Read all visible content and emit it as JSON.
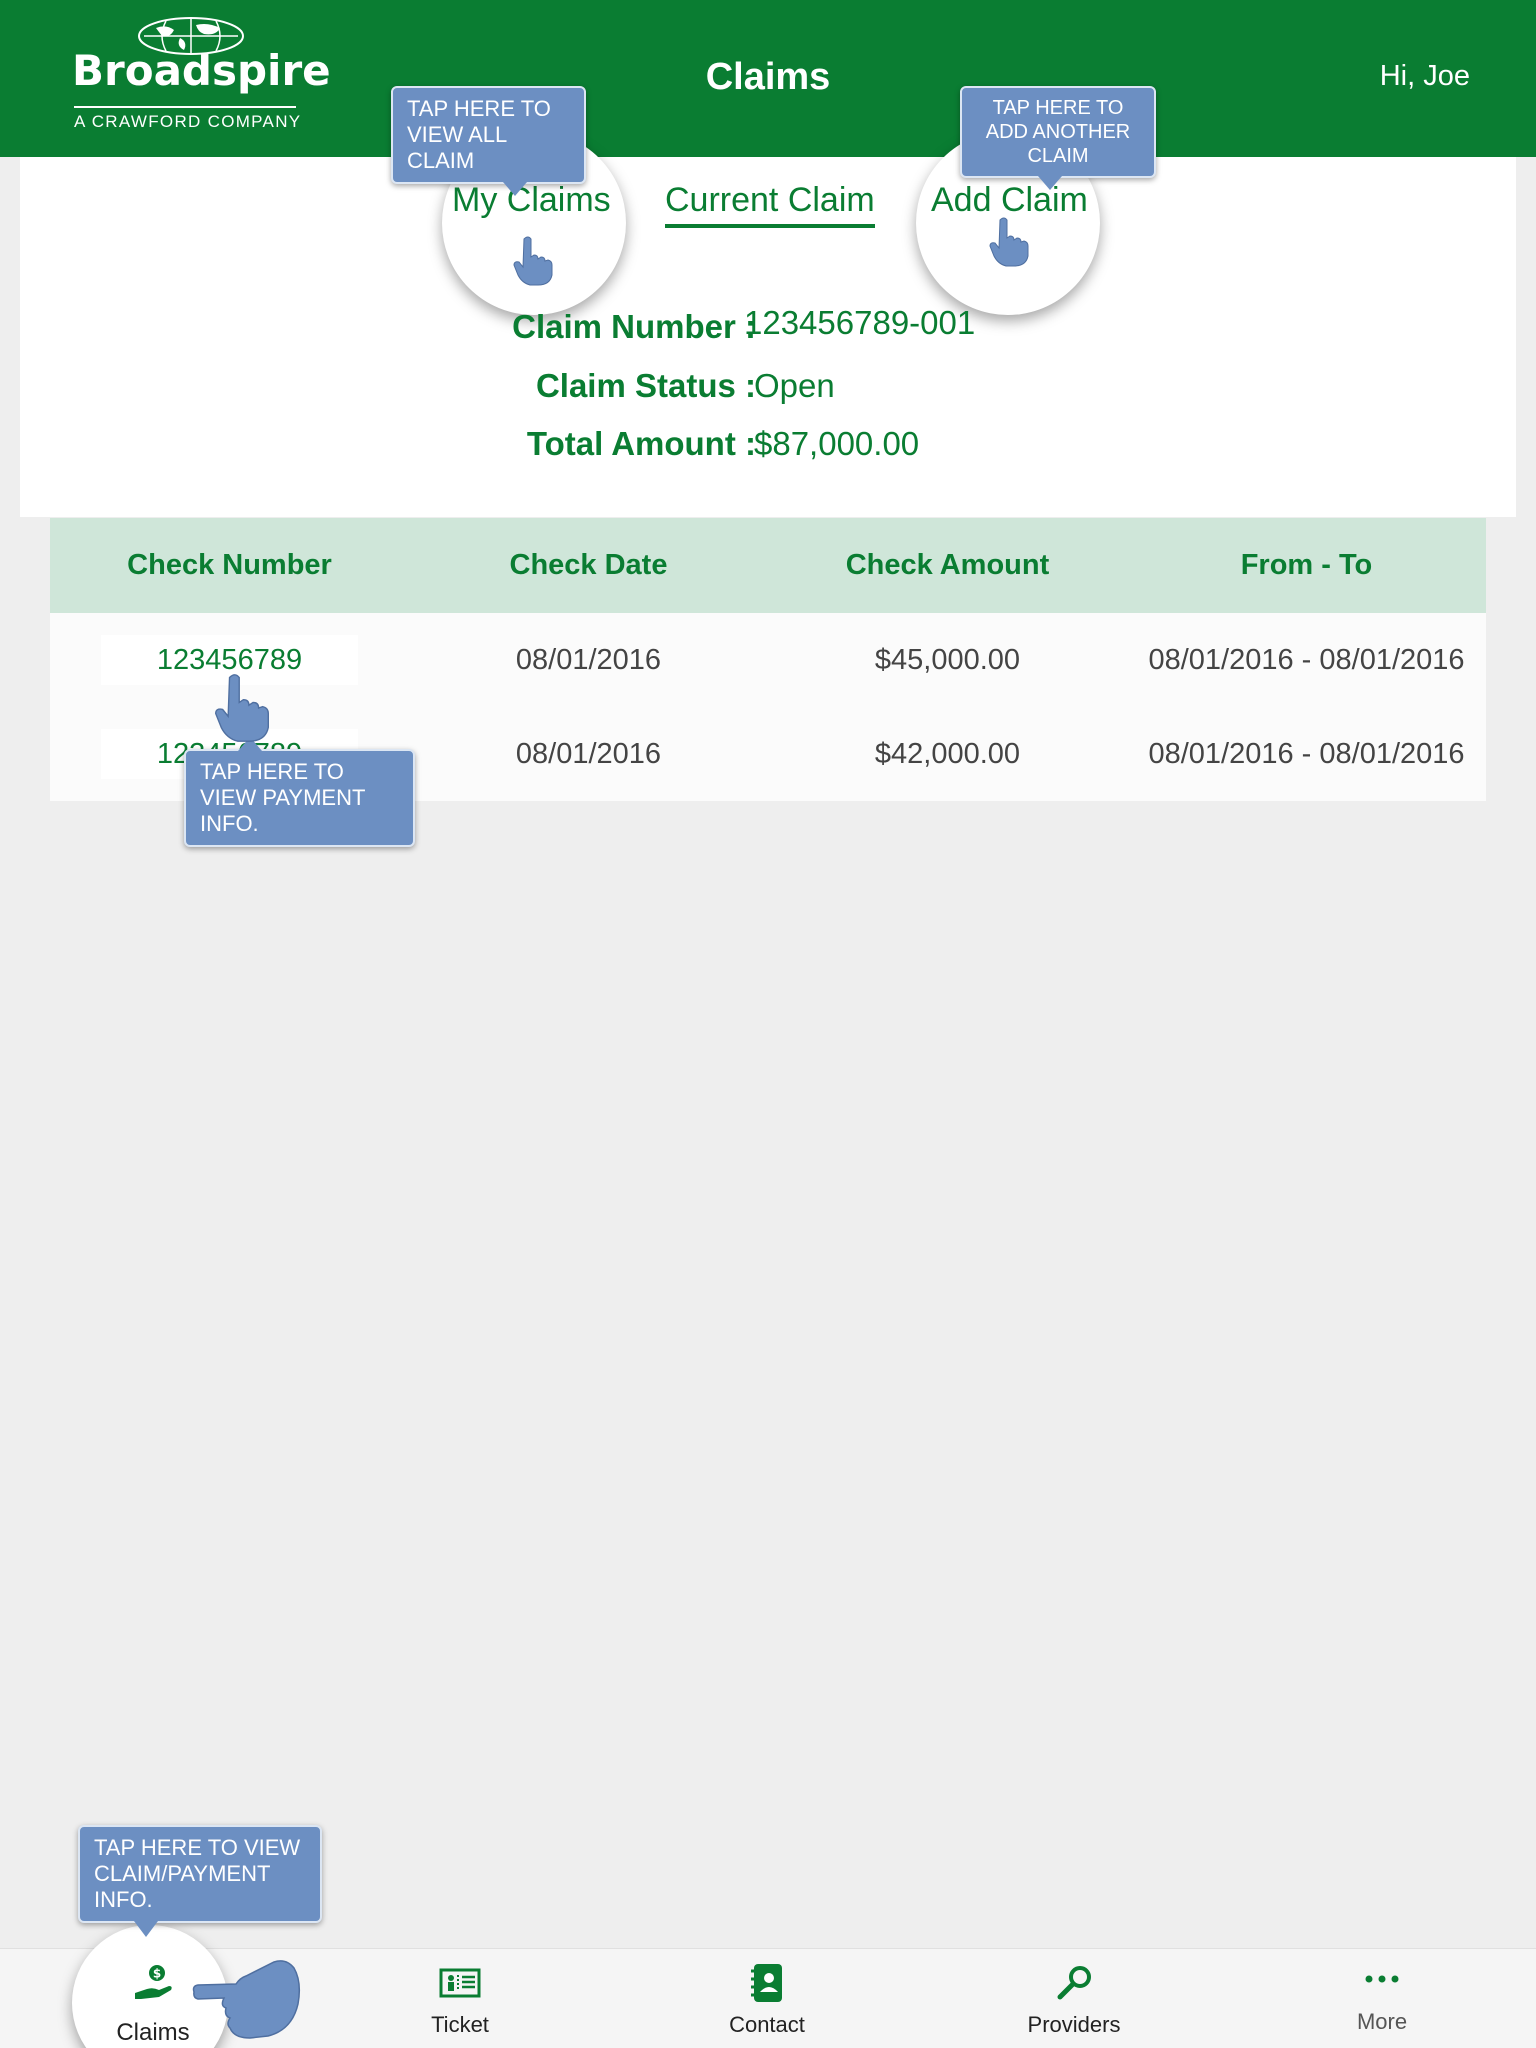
{
  "header": {
    "brand": "Broadspire",
    "brand_tagline": "A CRAWFORD COMPANY",
    "title": "Claims",
    "greeting": "Hi, Joe"
  },
  "tabs": {
    "my_claims": "My Claims",
    "current_claim": "Current Claim",
    "add_claim": "Add Claim",
    "active": "current_claim"
  },
  "claim": {
    "number_label": "Claim Number :",
    "number": "123456789-001",
    "status_label": "Claim Status :",
    "status": "Open",
    "total_label": "Total Amount :",
    "total": "$87,000.00"
  },
  "checks_table": {
    "columns": [
      "Check Number",
      "Check Date",
      "Check Amount",
      "From - To"
    ],
    "rows": [
      {
        "check_number": "123456789",
        "check_date": "08/01/2016",
        "check_amount": "$45,000.00",
        "from_to": "08/01/2016 - 08/01/2016"
      },
      {
        "check_number": "123456789",
        "check_date": "08/01/2016",
        "check_amount": "$42,000.00",
        "from_to": "08/01/2016 - 08/01/2016"
      }
    ]
  },
  "tutorial": {
    "my_claims_hint": "TAP HERE TO VIEW ALL CLAIM",
    "add_claim_hint": "TAP HERE TO ADD ANOTHER CLAIM",
    "payment_hint": "TAP HERE TO VIEW PAYMENT INFO.",
    "claims_tab_hint": "TAP HERE TO VIEW CLAIM/PAYMENT INFO."
  },
  "tabbar": {
    "items": [
      {
        "label": "Claims",
        "icon": "hand-dollar-icon",
        "active": true
      },
      {
        "label": "Ticket",
        "icon": "ticket-icon",
        "active": false
      },
      {
        "label": "Contact",
        "icon": "contact-book-icon",
        "active": false
      },
      {
        "label": "Providers",
        "icon": "magnifier-icon",
        "active": false
      },
      {
        "label": "More",
        "icon": "more-dots-icon",
        "active": false
      }
    ]
  },
  "colors": {
    "brand_green": "#0a7d32",
    "table_header_bg": "#cfe6d9",
    "tooltip_blue": "#6c8fc2",
    "background": "#eeeeee"
  }
}
